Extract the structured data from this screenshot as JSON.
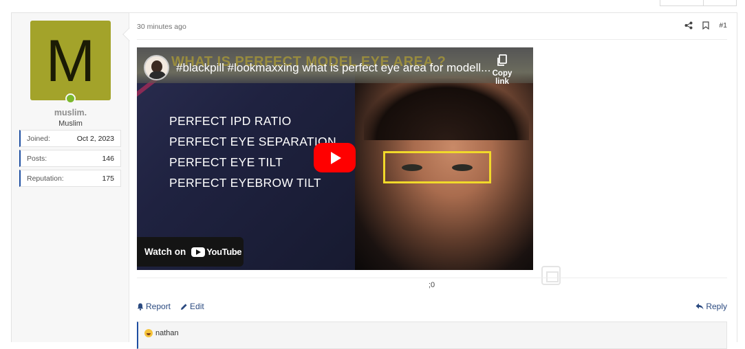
{
  "user": {
    "avatar_letter": "M",
    "avatar_color": "#a3a32a",
    "online_color": "#7cb82c",
    "username": "muslim.",
    "title": "Muslim",
    "stats": [
      {
        "label": "Joined:",
        "value": "Oct 2, 2023"
      },
      {
        "label": "Posts:",
        "value": "146"
      },
      {
        "label": "Reputation:",
        "value": "175"
      }
    ]
  },
  "post": {
    "time": "30 minutes ago",
    "number": "#1",
    "icons": [
      "share-icon",
      "bookmark-icon"
    ],
    "signature": ";0"
  },
  "video": {
    "title": "#blackpill #lookmaxxing what is perfect eye area for modell...",
    "thumbnail_heading": "WHAT IS PERFECT MODEL EYE AREA ?",
    "copy_label": "Copy link",
    "bullets": [
      "PERFECT IPD RATIO",
      "PERFECT EYE SEPARATION",
      "PERFECT EYE TILT",
      "PERFECT EYEBROW TILT"
    ],
    "watch_label": "Watch on",
    "youtube_label": "YouTube",
    "highlight_color": "#f1d92a",
    "play_color": "#ff0000"
  },
  "actions": {
    "report": "Report",
    "edit": "Edit",
    "reply": "Reply"
  },
  "reactions": {
    "user": "nathan",
    "icon": "laughing-emoji-icon"
  }
}
